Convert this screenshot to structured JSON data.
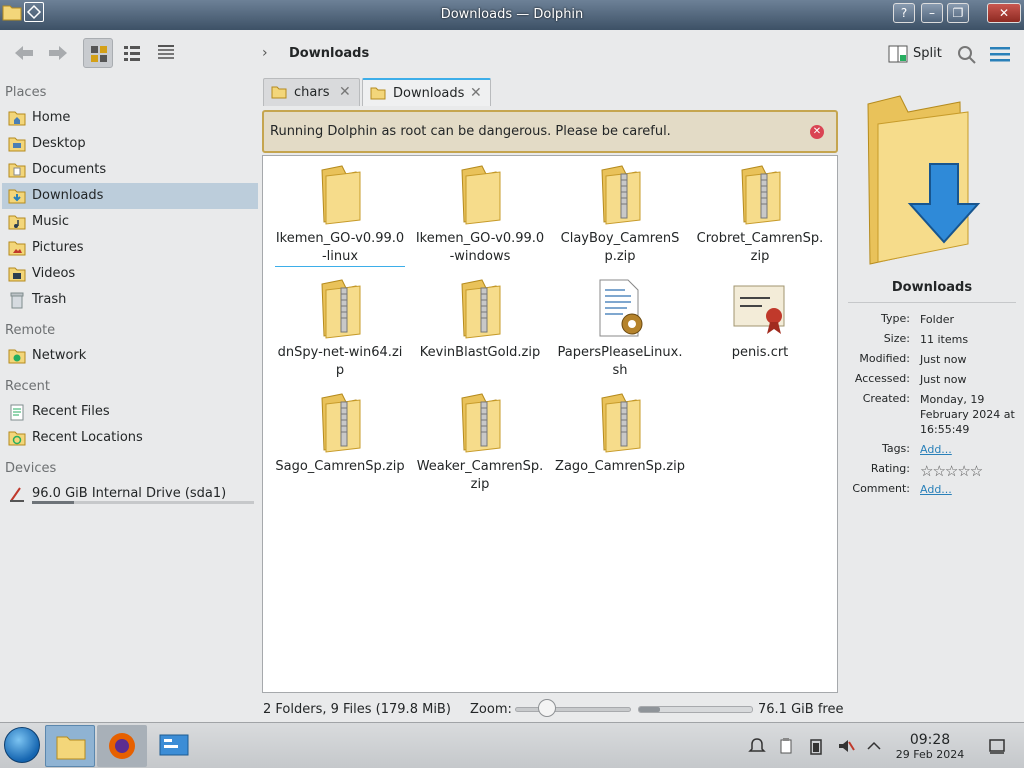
{
  "window": {
    "title": "Downloads — Dolphin"
  },
  "breadcrumb": {
    "current": "Downloads"
  },
  "toolbar": {
    "split_label": "Split"
  },
  "places": {
    "sections": {
      "places": "Places",
      "remote": "Remote",
      "recent": "Recent",
      "devices": "Devices"
    },
    "items": [
      {
        "label": "Home",
        "icon": "home-folder-icon"
      },
      {
        "label": "Desktop",
        "icon": "desktop-folder-icon"
      },
      {
        "label": "Documents",
        "icon": "documents-folder-icon"
      },
      {
        "label": "Downloads",
        "icon": "downloads-folder-icon",
        "selected": true
      },
      {
        "label": "Music",
        "icon": "music-folder-icon"
      },
      {
        "label": "Pictures",
        "icon": "pictures-folder-icon"
      },
      {
        "label": "Videos",
        "icon": "videos-folder-icon"
      },
      {
        "label": "Trash",
        "icon": "trash-icon"
      }
    ],
    "remote": [
      {
        "label": "Network",
        "icon": "network-icon"
      }
    ],
    "recent": [
      {
        "label": "Recent Files",
        "icon": "recent-files-icon"
      },
      {
        "label": "Recent Locations",
        "icon": "recent-locations-icon"
      }
    ],
    "devices": [
      {
        "label": "96.0 GiB Internal Drive (sda1)",
        "icon": "harddisk-icon",
        "usage": 0.19
      }
    ]
  },
  "tabs": [
    {
      "label": "chars",
      "active": false
    },
    {
      "label": "Downloads",
      "active": true
    }
  ],
  "warning": {
    "message": "Running Dolphin as root can be dangerous. Please be careful."
  },
  "files": [
    {
      "name": "Ikemen_GO-v0.99.0-linux",
      "type": "folder"
    },
    {
      "name": "Ikemen_GO-v0.99.0-windows",
      "type": "folder"
    },
    {
      "name": "ClayBoy_CamrenSp.zip",
      "type": "zip"
    },
    {
      "name": "Crobret_CamrenSp.zip",
      "type": "zip"
    },
    {
      "name": "dnSpy-net-win64.zip",
      "type": "zip"
    },
    {
      "name": "KevinBlastGold.zip",
      "type": "zip"
    },
    {
      "name": "PapersPleaseLinux.sh",
      "type": "script"
    },
    {
      "name": "penis.crt",
      "type": "certificate"
    },
    {
      "name": "Sago_CamrenSp.zip",
      "type": "zip"
    },
    {
      "name": "Weaker_CamrenSp.zip",
      "type": "zip"
    },
    {
      "name": "Zago_CamrenSp.zip",
      "type": "zip"
    }
  ],
  "status": {
    "summary": "2 Folders, 9 Files (179.8 MiB)",
    "zoom_label": "Zoom:",
    "zoom_level": 0.28,
    "free_space": "76.1 GiB free",
    "used_fraction": 0.19
  },
  "info_panel": {
    "name": "Downloads",
    "rows": [
      {
        "key": "Type:",
        "value": "Folder"
      },
      {
        "key": "Size:",
        "value": "11 items"
      },
      {
        "key": "Modified:",
        "value": "Just now"
      },
      {
        "key": "Accessed:",
        "value": "Just now"
      },
      {
        "key": "Created:",
        "value": "Monday, 19 February 2024 at 16:55:49"
      },
      {
        "key": "Tags:",
        "value": "Add...",
        "link": true
      },
      {
        "key": "Rating:",
        "value": "",
        "stars": 0
      },
      {
        "key": "Comment:",
        "value": "Add...",
        "link": true
      }
    ]
  },
  "taskbar": {
    "time": "09:28",
    "date": "29 Feb 2024"
  },
  "colors": {
    "accent": "#3daee9",
    "selection": "#bccddb",
    "warning_border": "#c5a54f"
  }
}
